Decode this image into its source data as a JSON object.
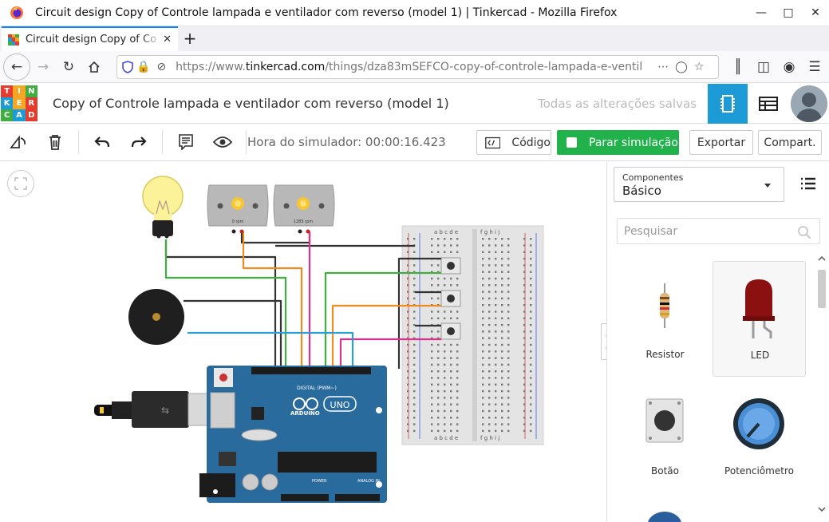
{
  "window": {
    "title": "Circuit design Copy of Controle lampada e ventilador com reverso (model 1) | Tinkercad - Mozilla Firefox"
  },
  "tab": {
    "label": "Circuit design Copy of Co",
    "new_tab": "+"
  },
  "nav": {
    "url_prefix": "https://www.",
    "url_domain": "tinkercad.com",
    "url_path": "/things/dza83mSEFCO-copy-of-controle-lampada-e-ventil"
  },
  "app": {
    "logo_letters": [
      "T",
      "I",
      "N",
      "K",
      "E",
      "R",
      "C",
      "A",
      "D"
    ],
    "doc_title": "Copy of Controle lampada e ventilador com reverso (model 1)",
    "saved_status": "Todas as alterações salvas"
  },
  "toolbar": {
    "sim_time": "Hora do simulador: 00:00:16.423",
    "code_label": "Código",
    "stop_label": "Parar simulação",
    "export_label": "Exportar",
    "share_label": "Compart."
  },
  "panel": {
    "components_caption": "Componentes",
    "components_value": "Básico",
    "search_placeholder": "Pesquisar",
    "items": [
      {
        "label": "Resistor"
      },
      {
        "label": "LED"
      },
      {
        "label": "Botão"
      },
      {
        "label": "Potenciômetro"
      }
    ]
  },
  "circuit": {
    "motor1_rpm": "0 rpm",
    "motor2_rpm": "1285 rpm",
    "board_name": "UNO",
    "board_brand": "ARDUINO",
    "digital_label": "DIGITAL (PWM~)",
    "power_label": "POWER",
    "analog_label": "ANALOG IN"
  },
  "colors": {
    "accent_blue": "#1d9bd7",
    "sim_green": "#22b24c",
    "arduino_blue": "#2a6b9e",
    "wire_green": "#3fae3f",
    "wire_orange": "#f08c1e",
    "wire_magenta": "#d6338a",
    "wire_cyan": "#2a9fd6",
    "wire_black": "#333333"
  }
}
